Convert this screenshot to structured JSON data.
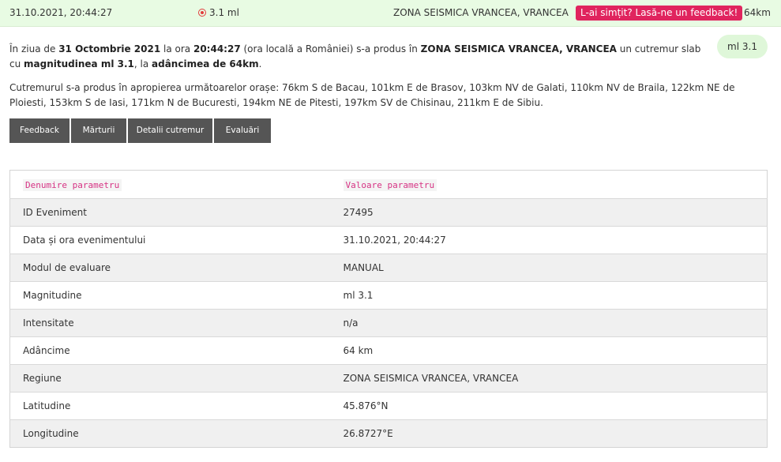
{
  "topbar": {
    "datetime": "31.10.2021, 20:44:27",
    "magnitude": "3.1 ml",
    "region": "ZONA SEISMICA VRANCEA, VRANCEA",
    "feedback_label": "L-ai simțit? Lasă-ne un feedback!",
    "depth": "64km",
    "icon": "quake-icon",
    "accent_color": "#e0245e",
    "bar_color": "#e8fbe3"
  },
  "summary": {
    "p1": "În ziua de ",
    "date": "31 Octombrie 2021",
    "p2": " la ora ",
    "time": "20:44:27",
    "p3": " (ora locală a României) s-a produs în ",
    "region": "ZONA SEISMICA VRANCEA, VRANCEA",
    "p4": " un cutremur slab cu ",
    "mag_label": "magnitudinea ml 3.1",
    "p5": ", la ",
    "depth_label": "adâncimea de 64km",
    "p6": ".",
    "mag_pill": "ml 3.1",
    "cities": "Cutremurul s-a produs în apropierea următoarelor orașe: 76km S de Bacau, 101km E de Brasov, 103km NV de Galati, 110km NV de Braila, 122km NE de Ploiesti, 153km S de Iasi, 171km N de Bucuresti, 194km NE de Pitesti, 197km SV de Chisinau, 211km E de Sibiu."
  },
  "tabs": [
    "Feedback",
    "Mărturii",
    "Detalii cutremur",
    "Evaluări"
  ],
  "table": {
    "headers": [
      "Denumire parametru",
      "Valoare parametru"
    ],
    "rows": [
      [
        "ID Eveniment",
        "27495"
      ],
      [
        "Data și ora evenimentului",
        "31.10.2021, 20:44:27"
      ],
      [
        "Modul de evaluare",
        "MANUAL"
      ],
      [
        "Magnitudine",
        "ml 3.1"
      ],
      [
        "Intensitate",
        "n/a"
      ],
      [
        "Adâncime",
        "64 km"
      ],
      [
        "Regiune",
        "ZONA SEISMICA VRANCEA, VRANCEA"
      ],
      [
        "Latitudine",
        "45.876°N"
      ],
      [
        "Longitudine",
        "26.8727°E"
      ]
    ]
  }
}
